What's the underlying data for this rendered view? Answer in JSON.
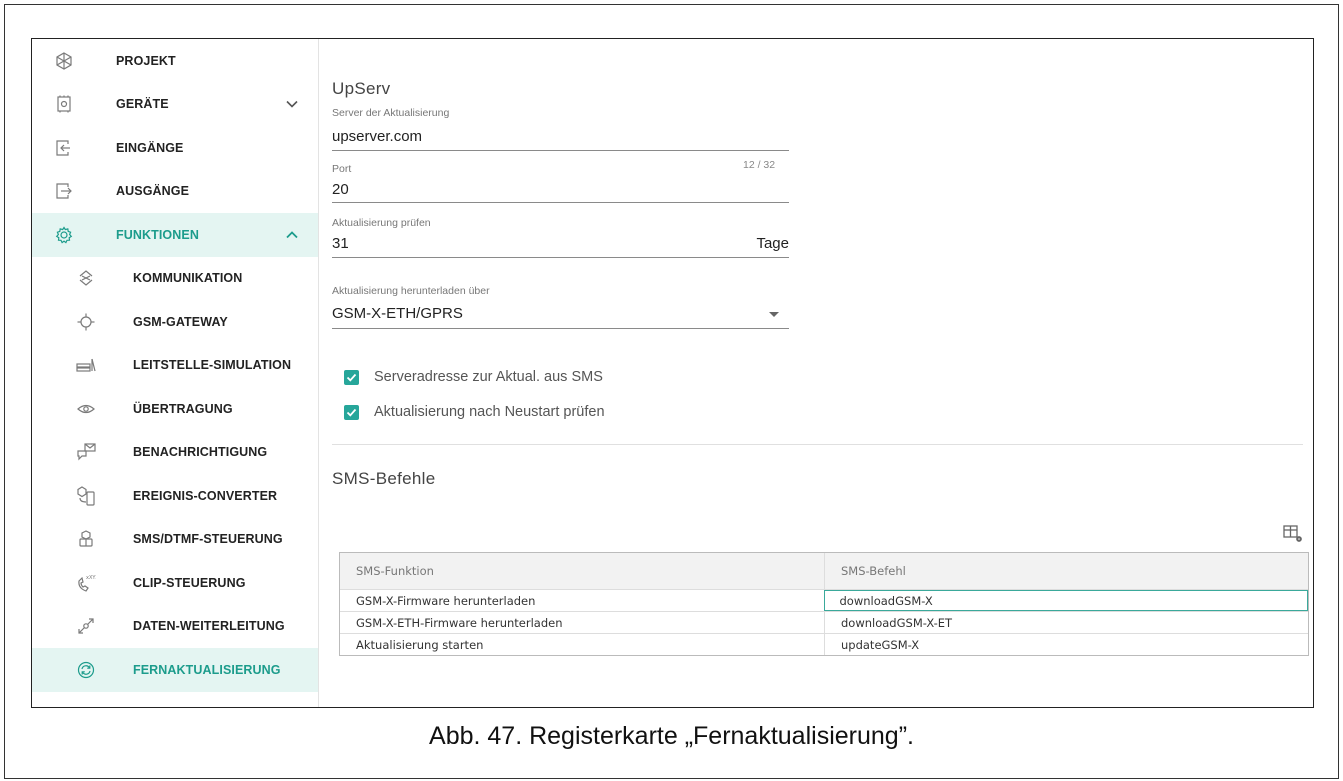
{
  "sidebar": {
    "items": [
      {
        "label": "PROJEKT",
        "icon": "project-snowflake-icon"
      },
      {
        "label": "GERÄTE",
        "icon": "device-module-icon"
      },
      {
        "label": "EINGÄNGE",
        "icon": "inputs-icon"
      },
      {
        "label": "AUSGÄNGE",
        "icon": "outputs-icon"
      },
      {
        "label": "FUNKTIONEN",
        "icon": "gear-icon"
      },
      {
        "label": "KOMMUNIKATION",
        "icon": "communication-icon"
      },
      {
        "label": "GSM-GATEWAY",
        "icon": "gsm-gateway-icon"
      },
      {
        "label": "LEITSTELLE-SIMULATION",
        "icon": "monitoring-station-icon"
      },
      {
        "label": "ÜBERTRAGUNG",
        "icon": "eye-icon"
      },
      {
        "label": "BENACHRICHTIGUNG",
        "icon": "notification-icon"
      },
      {
        "label": "EREIGNIS-CONVERTER",
        "icon": "event-converter-icon"
      },
      {
        "label": "SMS/DTMF-STEUERUNG",
        "icon": "sms-dtmf-icon"
      },
      {
        "label": "CLIP-STEUERUNG",
        "icon": "clip-phone-icon"
      },
      {
        "label": "DATEN-WEITERLEITUNG",
        "icon": "data-forwarding-icon"
      },
      {
        "label": "FERNAKTUALISIERUNG",
        "icon": "remote-update-icon"
      }
    ]
  },
  "upserv": {
    "title": "UpServ",
    "server": {
      "label": "Server der Aktualisierung",
      "value": "upserver.com",
      "counter": "12 / 32"
    },
    "port": {
      "label": "Port",
      "value": "20"
    },
    "check": {
      "label": "Aktualisierung prüfen",
      "value": "31",
      "suffix": "Tage"
    },
    "download": {
      "label": "Aktualisierung herunterladen über",
      "value": "GSM-X-ETH/GPRS"
    },
    "checkboxes": [
      {
        "label": "Serveradresse zur Aktual. aus SMS",
        "checked": true
      },
      {
        "label": "Aktualisierung nach Neustart prüfen",
        "checked": true
      }
    ]
  },
  "sms": {
    "title": "SMS-Befehle",
    "columns": [
      "SMS-Funktion",
      "SMS-Befehl"
    ],
    "rows": [
      [
        "GSM-X-Firmware herunterladen",
        "downloadGSM-X"
      ],
      [
        "GSM-X-ETH-Firmware herunterladen",
        "downloadGSM-X-ET"
      ],
      [
        "Aktualisierung starten",
        "updateGSM-X"
      ]
    ]
  },
  "caption": "Abb. 47. Registerkarte „Fernaktualisierung”.",
  "colors": {
    "accent": "#26a69a",
    "accent_bg": "#e4f5f2"
  }
}
